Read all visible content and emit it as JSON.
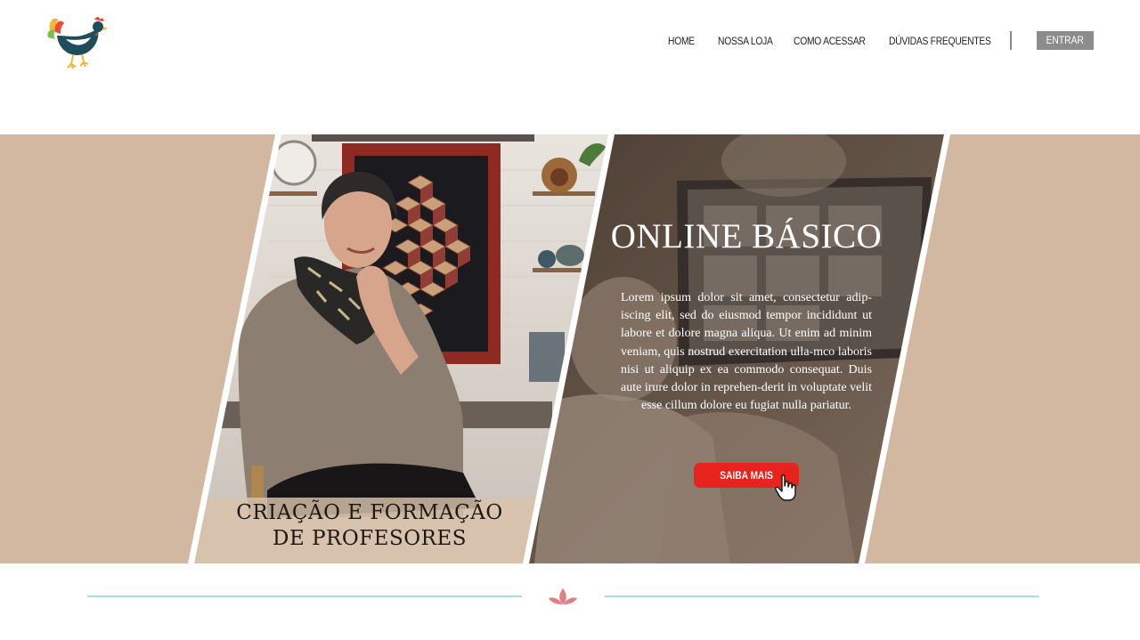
{
  "header": {
    "logo_icon": "rooster-logo-icon",
    "nav": [
      {
        "label": "HOME"
      },
      {
        "label": "NOSSA LOJA"
      },
      {
        "label": "COMO ACESSAR"
      },
      {
        "label": "DÚVIDAS FREQUENTES"
      }
    ],
    "login_label": "ENTRAR"
  },
  "hero": {
    "left_panel": {
      "caption_line1": "CRIAÇÃO E FORMAÇÃO",
      "caption_line2": "DE PROFESORES"
    },
    "right_panel": {
      "title": "ONLINE BÁSICO",
      "body": "Lorem ipsum dolor sit amet, consectetur adip-iscing elit, sed do eiusmod tempor incididunt ut labore et dolore magna aliqua. Ut enim ad minim veniam, quis nostrud exercitation ulla-mco laboris nisi ut aliquip ex ea commodo consequat. Duis aute irure dolor in reprehen-derit in voluptate velit esse cillum dolore eu fugiat nulla pariatur.",
      "cta_label": "SAIBA MAIS",
      "cursor_icon": "hand-pointer-icon"
    }
  },
  "divider": {
    "icon": "leaf-ornament-icon"
  },
  "colors": {
    "hero_background": "#d2b8a0",
    "cta": "#e8221c",
    "divider_line": "#a9dde7",
    "ornament": "#e07f86",
    "login_button": "#8c8c8c"
  }
}
